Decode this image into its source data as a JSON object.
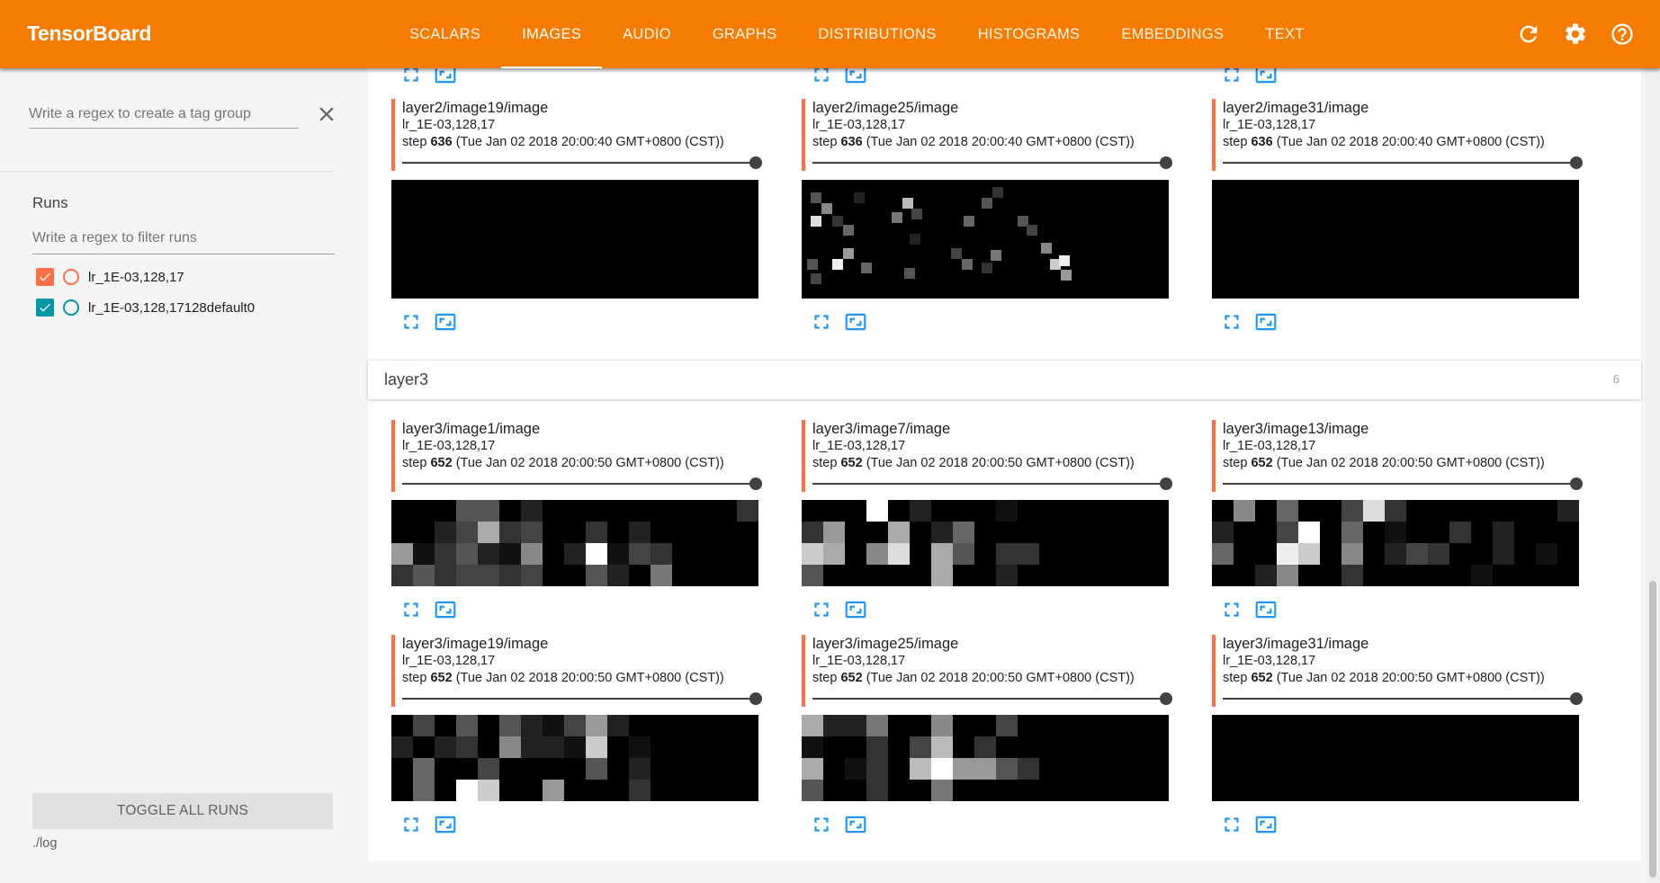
{
  "header": {
    "brand": "TensorBoard",
    "tabs": [
      {
        "label": "SCALARS",
        "active": false
      },
      {
        "label": "IMAGES",
        "active": true
      },
      {
        "label": "AUDIO",
        "active": false
      },
      {
        "label": "GRAPHS",
        "active": false
      },
      {
        "label": "DISTRIBUTIONS",
        "active": false
      },
      {
        "label": "HISTOGRAMS",
        "active": false
      },
      {
        "label": "EMBEDDINGS",
        "active": false
      },
      {
        "label": "TEXT",
        "active": false
      }
    ],
    "icons": [
      "reload-icon",
      "settings-icon",
      "help-icon"
    ]
  },
  "sidebar": {
    "tag_regex_placeholder": "Write a regex to create a tag group",
    "runs_title": "Runs",
    "runs_filter_placeholder": "Write a regex to filter runs",
    "runs": [
      {
        "label": "lr_1E-03,128,17",
        "checked": true,
        "color": "#ff7043"
      },
      {
        "label": "lr_1E-03,128,17128default0",
        "checked": true,
        "color": "#0097a7"
      }
    ],
    "toggle_label": "TOGGLE ALL RUNS",
    "logdir": "./log"
  },
  "colors": {
    "accent": "#f57c00",
    "run1": "#ff7043",
    "run2": "#0097a7",
    "action_icon": "#2196f3"
  },
  "layer2": {
    "panels": [
      {
        "tag": "layer2/image19/image",
        "run": "lr_1E-03,128,17",
        "step": "636",
        "time": "(Tue Jan 02 2018 20:00:40 GMT+0800 (CST))"
      },
      {
        "tag": "layer2/image25/image",
        "run": "lr_1E-03,128,17",
        "step": "636",
        "time": "(Tue Jan 02 2018 20:00:40 GMT+0800 (CST))"
      },
      {
        "tag": "layer2/image31/image",
        "run": "lr_1E-03,128,17",
        "step": "636",
        "time": "(Tue Jan 02 2018 20:00:40 GMT+0800 (CST))"
      }
    ]
  },
  "layer3": {
    "title": "layer3",
    "count": "6",
    "panels": [
      {
        "tag": "layer3/image1/image",
        "run": "lr_1E-03,128,17",
        "step": "652",
        "time": "(Tue Jan 02 2018 20:00:50 GMT+0800 (CST))"
      },
      {
        "tag": "layer3/image7/image",
        "run": "lr_1E-03,128,17",
        "step": "652",
        "time": "(Tue Jan 02 2018 20:00:50 GMT+0800 (CST))"
      },
      {
        "tag": "layer3/image13/image",
        "run": "lr_1E-03,128,17",
        "step": "652",
        "time": "(Tue Jan 02 2018 20:00:50 GMT+0800 (CST))"
      },
      {
        "tag": "layer3/image19/image",
        "run": "lr_1E-03,128,17",
        "step": "652",
        "time": "(Tue Jan 02 2018 20:00:50 GMT+0800 (CST))"
      },
      {
        "tag": "layer3/image25/image",
        "run": "lr_1E-03,128,17",
        "step": "652",
        "time": "(Tue Jan 02 2018 20:00:50 GMT+0800 (CST))"
      },
      {
        "tag": "layer3/image31/image",
        "run": "lr_1E-03,128,17",
        "step": "652",
        "time": "(Tue Jan 02 2018 20:00:50 GMT+0800 (CST))"
      }
    ]
  },
  "step_label": "step"
}
